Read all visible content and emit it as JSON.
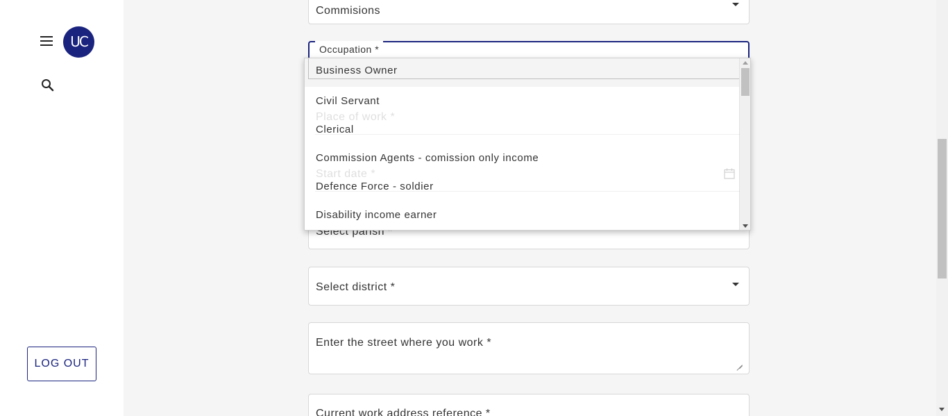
{
  "sidebar": {
    "menu_icon": "hamburger-menu-icon",
    "avatar_initials": "UC",
    "search_icon": "search-icon",
    "logout_label": "LOG OUT",
    "accent_color": "#1a237e"
  },
  "form": {
    "commisions_value": "Commisions",
    "occupation_label": "Occupation *",
    "place_of_work_placeholder": "Place of work *",
    "start_date_placeholder": "Start date *",
    "parish_placeholder": "Select parish *",
    "district_placeholder": "Select district *",
    "street_placeholder": "Enter the street where you work *",
    "address_reference_placeholder": "Current work address reference *"
  },
  "occupation_options": [
    "Business Owner",
    "Civil Servant",
    "Clerical",
    "Commission Agents - comission only income",
    "Defence Force - soldier",
    "Disability income earner"
  ]
}
